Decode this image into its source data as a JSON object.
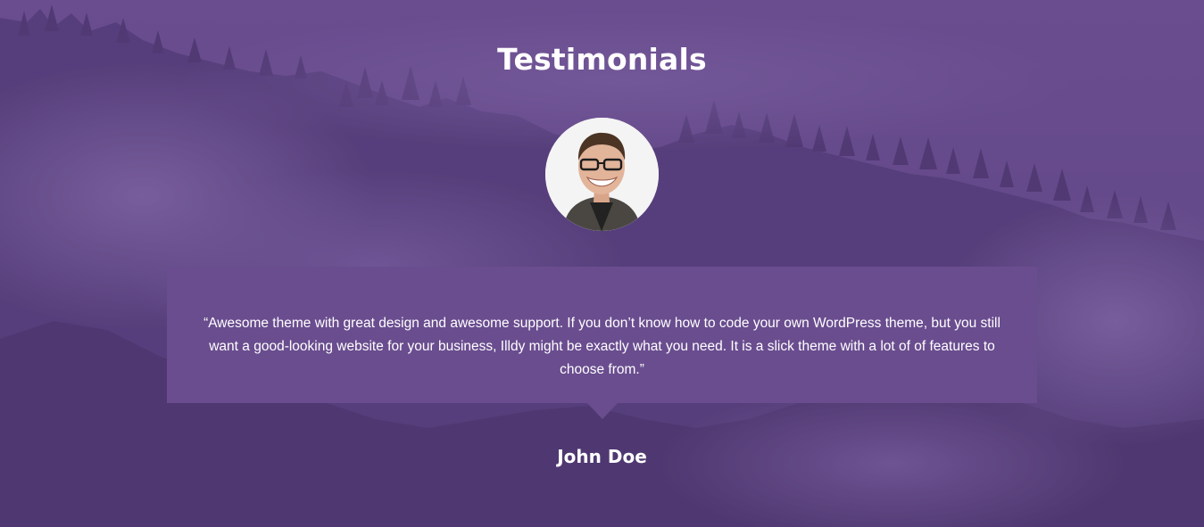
{
  "section": {
    "title": "Testimonials",
    "background_color": "#634a8c"
  },
  "testimonial": {
    "avatar_icon": "person-avatar",
    "quote": "“Awesome theme with great design and awesome support. If you don’t know how to code your own WordPress theme, but you still want a good-looking website for your business, Illdy might be exactly what you need. It is a slick theme with a lot of of features to choose from.”",
    "author": "John Doe",
    "box_color": "#6a4d8f"
  }
}
